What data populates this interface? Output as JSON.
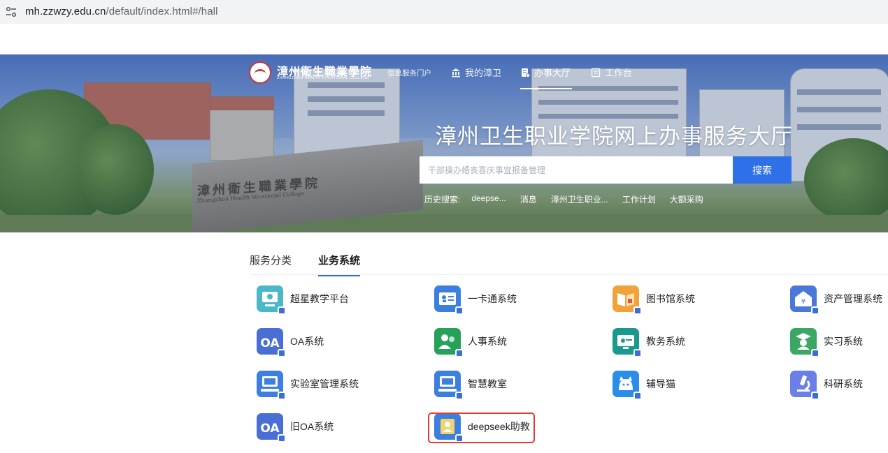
{
  "browser": {
    "url_host": "mh.zzwzy.edu.cn",
    "url_path": "/default/index.html#/hall"
  },
  "header": {
    "logo_cn": "漳州衛生職業學院",
    "logo_en": "ZHANGZHOU HEALTH VOCATIONAL COLLEGE",
    "nav": [
      {
        "label": "信息服务门户",
        "icon": ""
      },
      {
        "label": "我的漳卫",
        "icon": "building-icon"
      },
      {
        "label": "办事大厅",
        "icon": "document-icon"
      },
      {
        "label": "工作台",
        "icon": "board-icon"
      }
    ]
  },
  "hero": {
    "title": "漳州卫生职业学院网上办事服务大厅",
    "wall_text": "漳州衛生職業學院",
    "wall_en": "Zhangzhou Health Vocational College"
  },
  "search": {
    "placeholder": "干部操办婚丧喜庆事宜报备管理",
    "button": "搜索",
    "history_label": "历史搜索:",
    "history": [
      "deepse...",
      "消息",
      "漳州卫生职业...",
      "工作计划",
      "大额采购"
    ]
  },
  "tabs": [
    {
      "label": "服务分类",
      "active": false
    },
    {
      "label": "业务系统",
      "active": true
    }
  ],
  "systems": [
    {
      "label": "超星教学平台",
      "icon": "monitor-cloud-icon",
      "color": "#4ab8c9"
    },
    {
      "label": "一卡通系统",
      "icon": "id-card-icon",
      "color": "#3d7fe0"
    },
    {
      "label": "图书馆系统",
      "icon": "book-icon",
      "color": "#f0a33a"
    },
    {
      "label": "资产管理系统",
      "icon": "asset-house-icon",
      "color": "#4a78d8"
    },
    {
      "label": "OA系统",
      "icon": "oa-icon",
      "color": "#4a6fd4"
    },
    {
      "label": "人事系统",
      "icon": "people-icon",
      "color": "#27a05a"
    },
    {
      "label": "教务系统",
      "icon": "presentation-icon",
      "color": "#1a9a8e"
    },
    {
      "label": "实习系统",
      "icon": "graduate-icon",
      "color": "#3aa864"
    },
    {
      "label": "实验室管理系统",
      "icon": "lab-computer-icon",
      "color": "#3d7fe0"
    },
    {
      "label": "智慧教室",
      "icon": "classroom-icon",
      "color": "#3d7fe0"
    },
    {
      "label": "辅导猫",
      "icon": "cat-icon",
      "color": "#2a8ee8"
    },
    {
      "label": "科研系统",
      "icon": "microscope-icon",
      "color": "#6a7fe8"
    },
    {
      "label": "旧OA系统",
      "icon": "old-oa-icon",
      "color": "#4a6fd4"
    },
    {
      "label": "deepseek助教",
      "icon": "assistant-icon",
      "color": "#3d7fe0"
    }
  ]
}
